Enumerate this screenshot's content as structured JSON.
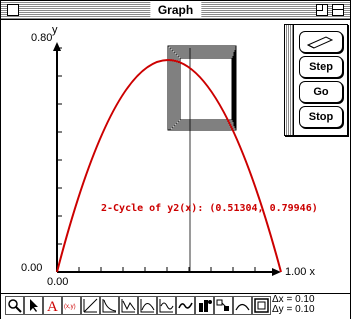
{
  "window": {
    "title": "Graph"
  },
  "axes": {
    "y_label": "y",
    "y_max_label": "0.80",
    "y_min_label": "0.00",
    "x_min_label": "0.00",
    "x_max_label": "1.00 x"
  },
  "annotation": {
    "cycle_text": "2-Cycle of y2(x): (0.51304,  0.79946)"
  },
  "palette": {
    "step": "Step",
    "go": "Go",
    "stop": "Stop"
  },
  "footer": {
    "dx": "Δx = 0.10",
    "dy": "Δy = 0.10"
  },
  "tools": [
    "magnifier-icon",
    "arrow-icon",
    "text-icon",
    "point-label-icon",
    "line-icon",
    "curve1-icon",
    "curve2-icon",
    "curve3-icon",
    "wave-icon",
    "derivative-icon",
    "integral-icon",
    "function-icon",
    "hump-icon",
    "window-icon"
  ],
  "colors": {
    "curve": "#cc0000",
    "label": "#cc0000"
  }
}
